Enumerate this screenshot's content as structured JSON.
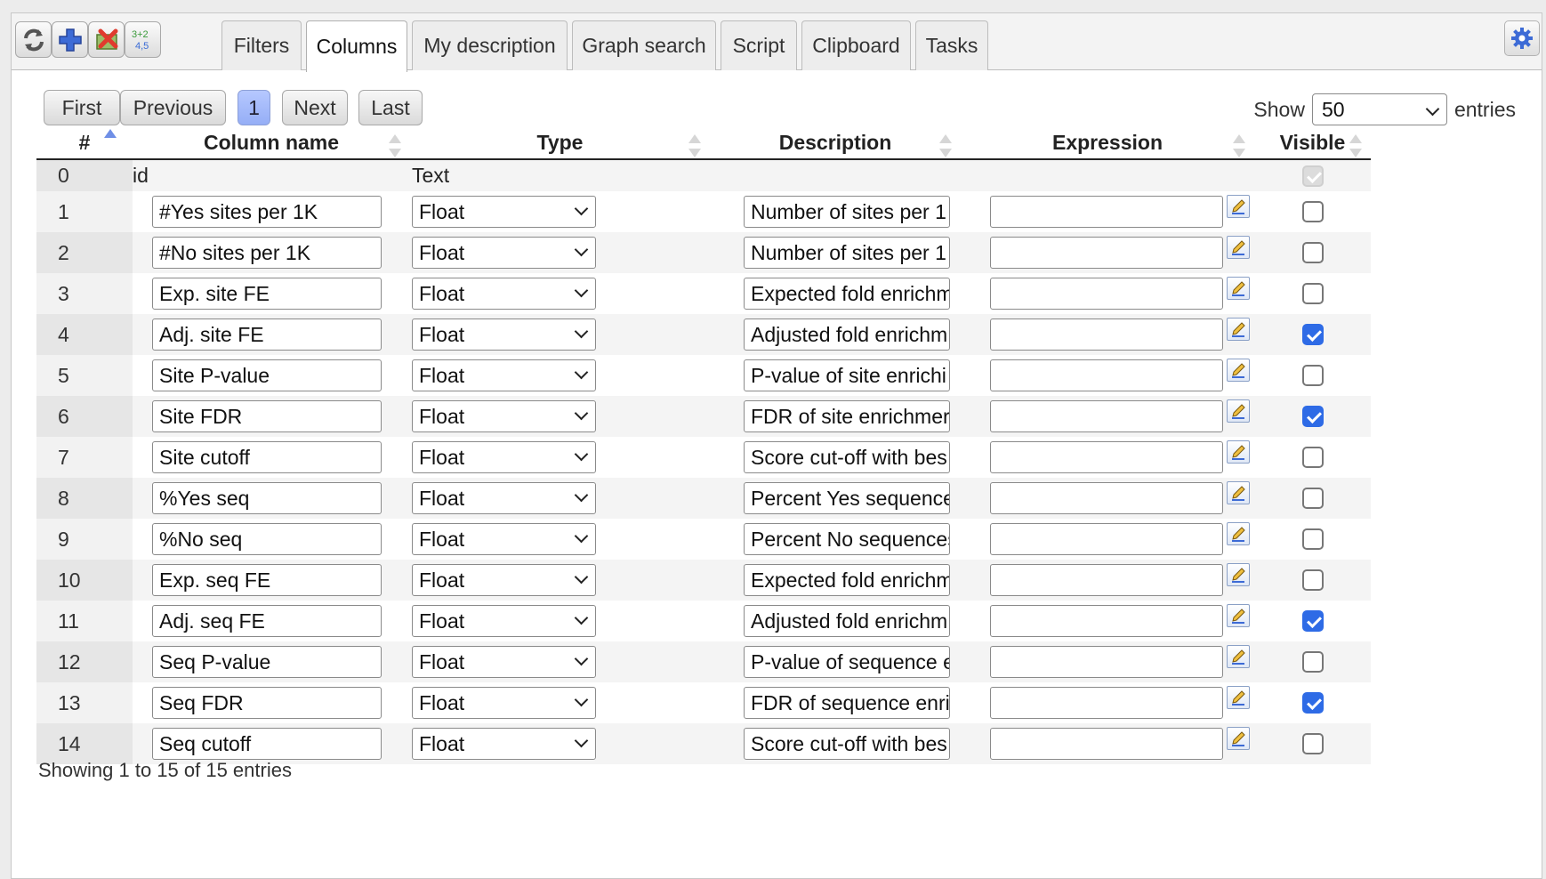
{
  "toolbar": {
    "refresh_icon": "refresh-icon",
    "add_icon": "plus-icon",
    "remove_icon": "delete-icon",
    "calc_icon": "calculator-icon",
    "calc_text_top": "3+2",
    "calc_text_bottom": "4,5",
    "settings_icon": "gear-icon",
    "colors": {
      "plus": "#3d6bd6",
      "remove": "#e03b2e",
      "gear": "#3d6bd6"
    }
  },
  "tabs": [
    {
      "label": "Filters",
      "active": false
    },
    {
      "label": "Columns",
      "active": true
    },
    {
      "label": "My description",
      "active": false
    },
    {
      "label": "Graph search",
      "active": false
    },
    {
      "label": "Script",
      "active": false
    },
    {
      "label": "Clipboard",
      "active": false
    },
    {
      "label": "Tasks",
      "active": false
    }
  ],
  "pager": {
    "first": "First",
    "previous": "Previous",
    "current_page": "1",
    "next": "Next",
    "last": "Last"
  },
  "length": {
    "show_label": "Show",
    "value": "50",
    "entries_label": "entries"
  },
  "table": {
    "headers": [
      "#",
      "Column name",
      "Type",
      "Description",
      "Expression",
      "Visible"
    ],
    "sorted_column": "#",
    "rows": [
      {
        "n": "0",
        "name": "id",
        "type": "Text",
        "description": "",
        "expression": "",
        "visible": true,
        "editable": false
      },
      {
        "n": "1",
        "name": "#Yes sites per 1K",
        "type": "Float",
        "description": "Number of sites per 1",
        "expression": "",
        "visible": false,
        "editable": true
      },
      {
        "n": "2",
        "name": "#No sites per 1K",
        "type": "Float",
        "description": "Number of sites per 1",
        "expression": "",
        "visible": false,
        "editable": true
      },
      {
        "n": "3",
        "name": "Exp. site FE",
        "type": "Float",
        "description": "Expected fold enrichm",
        "expression": "",
        "visible": false,
        "editable": true
      },
      {
        "n": "4",
        "name": "Adj. site FE",
        "type": "Float",
        "description": "Adjusted fold enrichm",
        "expression": "",
        "visible": true,
        "editable": true
      },
      {
        "n": "5",
        "name": "Site P-value",
        "type": "Float",
        "description": "P-value of site enrichi",
        "expression": "",
        "visible": false,
        "editable": true
      },
      {
        "n": "6",
        "name": "Site FDR",
        "type": "Float",
        "description": "FDR of site enrichmer",
        "expression": "",
        "visible": true,
        "editable": true
      },
      {
        "n": "7",
        "name": "Site cutoff",
        "type": "Float",
        "description": "Score cut-off with bes",
        "expression": "",
        "visible": false,
        "editable": true
      },
      {
        "n": "8",
        "name": "%Yes seq",
        "type": "Float",
        "description": "Percent Yes sequence",
        "expression": "",
        "visible": false,
        "editable": true
      },
      {
        "n": "9",
        "name": "%No seq",
        "type": "Float",
        "description": "Percent No sequences",
        "expression": "",
        "visible": false,
        "editable": true
      },
      {
        "n": "10",
        "name": "Exp. seq FE",
        "type": "Float",
        "description": "Expected fold enrichm",
        "expression": "",
        "visible": false,
        "editable": true
      },
      {
        "n": "11",
        "name": "Adj. seq FE",
        "type": "Float",
        "description": "Adjusted fold enrichm",
        "expression": "",
        "visible": true,
        "editable": true
      },
      {
        "n": "12",
        "name": "Seq P-value",
        "type": "Float",
        "description": "P-value of sequence e",
        "expression": "",
        "visible": false,
        "editable": true
      },
      {
        "n": "13",
        "name": "Seq FDR",
        "type": "Float",
        "description": "FDR of sequence enri",
        "expression": "",
        "visible": true,
        "editable": true
      },
      {
        "n": "14",
        "name": "Seq cutoff",
        "type": "Float",
        "description": "Score cut-off with bes",
        "expression": "",
        "visible": false,
        "editable": true
      }
    ]
  },
  "footer": {
    "info": "Showing 1 to 15 of 15 entries"
  }
}
